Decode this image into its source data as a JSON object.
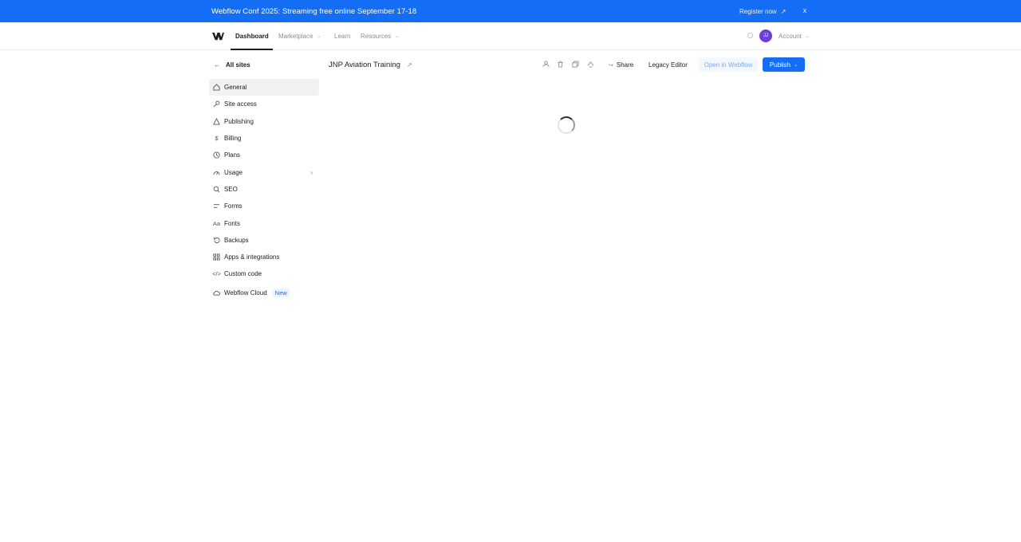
{
  "banner": {
    "text": "Webflow Conf 2025: Streaming free online September 17-18",
    "register_label": "Register now",
    "register_icon": "arrow-up-right-icon",
    "close_label": "x"
  },
  "nav": {
    "links": [
      {
        "label": "Dashboard",
        "active": true
      },
      {
        "label": "Marketplace",
        "dropdown": true
      },
      {
        "label": "Learn",
        "dropdown": false
      },
      {
        "label": "Resources",
        "dropdown": true
      }
    ],
    "avatar_initials": "JJ",
    "account_label": "Account",
    "caret": "⌄"
  },
  "sidebar": {
    "back_label": "All sites",
    "items": [
      {
        "label": "General",
        "icon": "home-icon",
        "active": true
      },
      {
        "label": "Site access",
        "icon": "key-icon"
      },
      {
        "label": "Publishing",
        "icon": "publish-icon"
      },
      {
        "label": "Billing",
        "icon": "dollar-icon"
      },
      {
        "label": "Plans",
        "icon": "plans-icon"
      },
      {
        "label": "Usage",
        "icon": "usage-icon",
        "chevron": "›"
      },
      {
        "label": "SEO",
        "icon": "search-icon"
      },
      {
        "label": "Forms",
        "icon": "forms-icon"
      },
      {
        "label": "Fonts",
        "icon": "fonts-icon"
      },
      {
        "label": "Backups",
        "icon": "backup-icon"
      },
      {
        "label": "Apps & integrations",
        "icon": "apps-icon"
      },
      {
        "label": "Custom code",
        "icon": "code-icon"
      },
      {
        "label": "Webflow Cloud",
        "icon": "cloud-icon",
        "badge": "New"
      }
    ]
  },
  "main": {
    "site_title": "JNP Aviation Training",
    "share_label": "Share",
    "legacy_label": "Legacy Editor",
    "open_label": "Open in Webflow",
    "publish_label": "Publish"
  },
  "colors": {
    "brand_blue": "#146ef5",
    "avatar_purple": "#6b3fd8"
  }
}
